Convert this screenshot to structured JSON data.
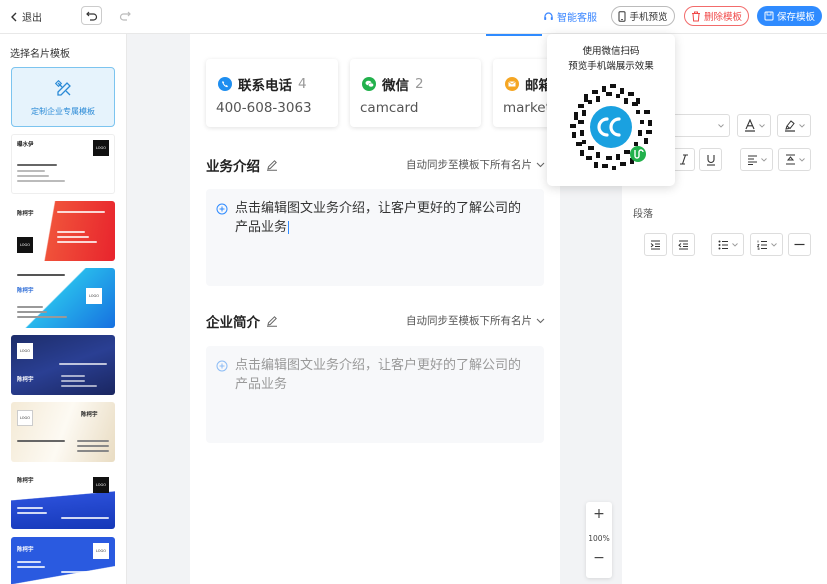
{
  "topbar": {
    "back_label": "退出",
    "service_label": "智能客服",
    "preview_label": "手机预览",
    "delete_label": "删除模板",
    "save_label": "保存模板"
  },
  "sidebar": {
    "title": "选择名片模板",
    "custom_label": "定制企业专属模板",
    "templates": [
      {
        "name": "曝水伊",
        "company": "深圳某某科技有限公司"
      },
      {
        "name": "陈柯宇",
        "company": "上海市企业信息技术有限公司"
      },
      {
        "name": "陈柯宇",
        "company": "上海市企业信息技术有限公司"
      },
      {
        "name": "陈柯宇",
        "company": "上海市企业信息技术有限公司"
      },
      {
        "name": "陈柯宇",
        "company": "上海市企业信息技术有限公司"
      },
      {
        "name": "陈柯宇",
        "company": "上海市企业信息技术有限公司"
      },
      {
        "name": "陈柯宇",
        "company": "上海市企业信息技术有限公司"
      }
    ],
    "logo_text": "LOGO"
  },
  "contacts": [
    {
      "label": "联系电话",
      "count": "4",
      "value": "400-608-3063",
      "color": "#1e8ef0"
    },
    {
      "label": "微信",
      "count": "2",
      "value": "camcard",
      "color": "#22b14c"
    },
    {
      "label": "邮箱",
      "count": "",
      "value": "market",
      "color": "#f5a623"
    }
  ],
  "sections": [
    {
      "title": "业务介绍",
      "sync": "自动同步至模板下所有名片",
      "content": "点击编辑图文业务介绍，让客户更好的了解公司的产品业务"
    },
    {
      "title": "企业简介",
      "sync": "自动同步至模板下所有名片",
      "content": "点击编辑图文业务介绍，让客户更好的了解公司的产品业务"
    }
  ],
  "qr_popup": {
    "line1": "使用微信扫码",
    "line2": "预览手机端展示效果"
  },
  "right_panel": {
    "paragraph_label": "段落"
  },
  "zoom": {
    "plus": "+",
    "value": "100%",
    "minus": "−"
  }
}
